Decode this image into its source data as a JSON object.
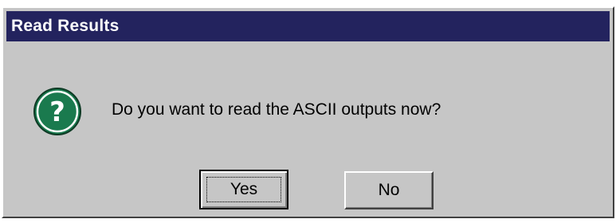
{
  "window": {
    "title": "Read Results"
  },
  "message": {
    "text": "Do you want to read the ASCII outputs now?"
  },
  "icon": {
    "name": "question-icon",
    "glyph": "?",
    "color": "#1a7a4e"
  },
  "buttons": {
    "yes_label": "Yes",
    "no_label": "No"
  },
  "colors": {
    "titlebar": "#23235e",
    "dialog_bg": "#c6c6c6"
  }
}
